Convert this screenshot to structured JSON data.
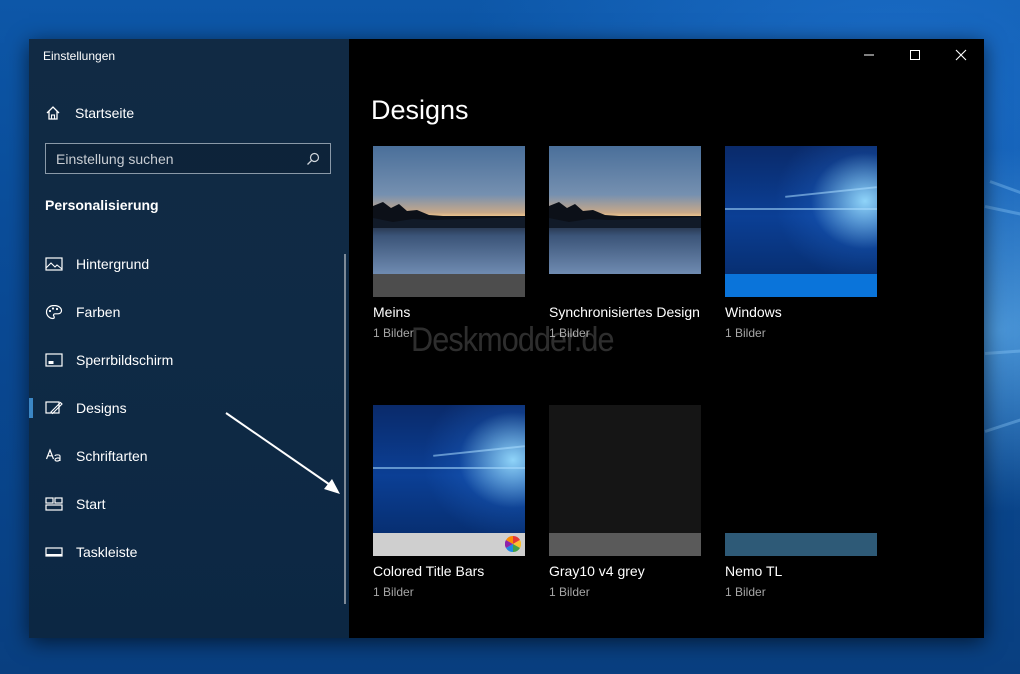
{
  "window": {
    "app_title": "Einstellungen",
    "home_label": "Startseite",
    "search_placeholder": "Einstellung suchen",
    "section_title": "Personalisierung"
  },
  "nav": [
    {
      "label": "Hintergrund",
      "icon": "image-icon",
      "selected": false
    },
    {
      "label": "Farben",
      "icon": "palette-icon",
      "selected": false
    },
    {
      "label": "Sperrbildschirm",
      "icon": "lock-screen-icon",
      "selected": false
    },
    {
      "label": "Designs",
      "icon": "themes-icon",
      "selected": true
    },
    {
      "label": "Schriftarten",
      "icon": "fonts-icon",
      "selected": false
    },
    {
      "label": "Start",
      "icon": "start-icon",
      "selected": false
    },
    {
      "label": "Taskleiste",
      "icon": "taskbar-icon",
      "selected": false
    }
  ],
  "content": {
    "title": "Designs",
    "watermark": "Deskmodder.de",
    "themes": [
      {
        "name": "Meins",
        "count": "1 Bilder",
        "thumbnail": "lake",
        "bar_color": "#4d4d4d"
      },
      {
        "name": "Synchronisiertes Design",
        "count": "1 Bilder",
        "thumbnail": "lake",
        "bar_color": null
      },
      {
        "name": "Windows",
        "count": "1 Bilder",
        "thumbnail": "windows",
        "bar_color": "#0a74da"
      },
      {
        "name": "Colored Title Bars",
        "count": "1 Bilder",
        "thumbnail": "windows",
        "bar_color": "#cfcfcf"
      },
      {
        "name": "Gray10 v4 grey",
        "count": "1 Bilder",
        "thumbnail": "dark-gray",
        "bar_color": "#5a5a5a"
      },
      {
        "name": "Nemo TL",
        "count": "1 Bilder",
        "thumbnail": "black",
        "bar_color": "#2e5a77"
      }
    ]
  },
  "colors": {
    "sidebar_bg": "#112a44",
    "content_bg": "#000000",
    "accent": "#3b87c5"
  }
}
